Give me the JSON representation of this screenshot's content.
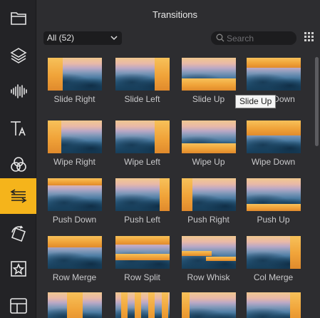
{
  "colors": {
    "accent": "#f5b41b",
    "panel": "#2d2d30",
    "sidebar": "#232326"
  },
  "sidebar": {
    "items": [
      {
        "icon": "folder-icon",
        "name": "media"
      },
      {
        "icon": "layers-icon",
        "name": "layers"
      },
      {
        "icon": "audio-waveform-icon",
        "name": "audio"
      },
      {
        "icon": "text-icon",
        "name": "text"
      },
      {
        "icon": "color-circles-icon",
        "name": "color"
      },
      {
        "icon": "transitions-icon",
        "name": "transitions",
        "active": true
      },
      {
        "icon": "rotate-square-icon",
        "name": "transform"
      },
      {
        "icon": "star-frame-icon",
        "name": "stickers"
      },
      {
        "icon": "layout-icon",
        "name": "templates"
      }
    ]
  },
  "header": {
    "title": "Transitions"
  },
  "filter": {
    "selected": "All (52)"
  },
  "search": {
    "placeholder": "Search"
  },
  "tooltip": {
    "text": "Slide Up"
  },
  "transitions": [
    {
      "label": "Slide Right",
      "style": "slide-right"
    },
    {
      "label": "Slide Left",
      "style": "slide-left"
    },
    {
      "label": "Slide Up",
      "style": "slide-up"
    },
    {
      "label": "Slide Down",
      "style": "slide-down"
    },
    {
      "label": "Wipe Right",
      "style": "wipe-right"
    },
    {
      "label": "Wipe Left",
      "style": "wipe-left"
    },
    {
      "label": "Wipe Up",
      "style": "wipe-up"
    },
    {
      "label": "Wipe Down",
      "style": "wipe-down"
    },
    {
      "label": "Push Down",
      "style": "push-down"
    },
    {
      "label": "Push Left",
      "style": "push-left"
    },
    {
      "label": "Push Right",
      "style": "push-right"
    },
    {
      "label": "Push Up",
      "style": "push-up"
    },
    {
      "label": "Row Merge",
      "style": "row-merge"
    },
    {
      "label": "Row Split",
      "style": "row-split"
    },
    {
      "label": "Row Whisk",
      "style": "row-whisk"
    },
    {
      "label": "Col Merge",
      "style": "col-merge"
    },
    {
      "label": "",
      "style": "col-a"
    },
    {
      "label": "",
      "style": "col-b"
    },
    {
      "label": "",
      "style": "col-c"
    },
    {
      "label": "",
      "style": "col-d"
    }
  ]
}
